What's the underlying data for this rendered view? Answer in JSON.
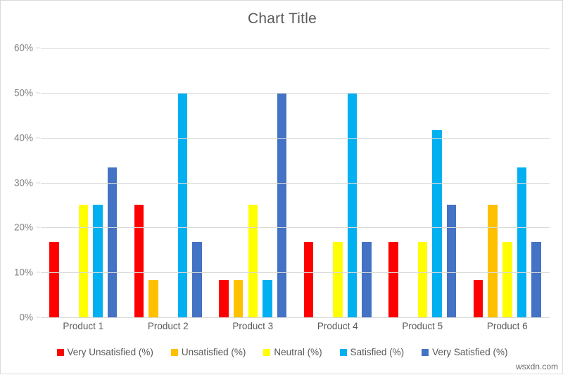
{
  "chart": {
    "title": "Chart Title",
    "watermark": "wsxdn.com"
  },
  "chart_data": {
    "type": "bar",
    "title": "Chart Title",
    "xlabel": "",
    "ylabel": "",
    "ylim": [
      0,
      60
    ],
    "ytick_labels": [
      "60%",
      "50%",
      "40%",
      "30%",
      "20%",
      "10%",
      "0%"
    ],
    "ytick_values": [
      60,
      50,
      40,
      30,
      20,
      10,
      0
    ],
    "grid": true,
    "legend_position": "bottom",
    "categories": [
      "Product 1",
      "Product 2",
      "Product 3",
      "Product 4",
      "Product 5",
      "Product 6"
    ],
    "series": [
      {
        "name": "Very Unsatisfied (%)",
        "color": "#FF0000",
        "values": [
          16.7,
          25.0,
          8.3,
          16.7,
          16.7,
          8.3
        ]
      },
      {
        "name": "Unsatisfied (%)",
        "color": "#FFC000",
        "values": [
          0,
          8.3,
          8.3,
          0,
          0,
          25.0
        ]
      },
      {
        "name": "Neutral (%)",
        "color": "#FFFF00",
        "values": [
          25.0,
          0,
          25.0,
          16.7,
          16.7,
          16.7
        ]
      },
      {
        "name": "Satisfied (%)",
        "color": "#00B0F0",
        "values": [
          25.0,
          50.0,
          8.3,
          50.0,
          41.7,
          33.3
        ]
      },
      {
        "name": "Very Satisfied (%)",
        "color": "#4472C4",
        "values": [
          33.3,
          16.7,
          50.0,
          16.7,
          25.0,
          16.7
        ]
      }
    ]
  }
}
